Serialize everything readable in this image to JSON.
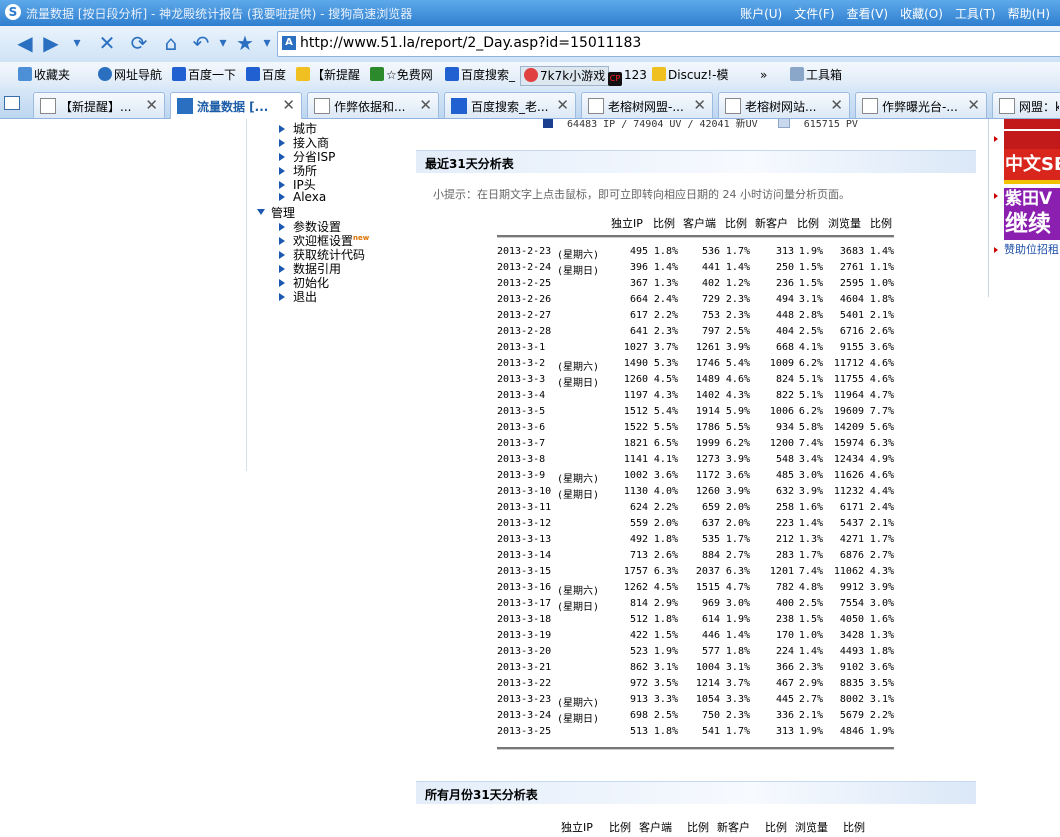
{
  "window": {
    "title": "流量数据 [按日段分析] - 神龙殿统计报告 (我要啦提供) - 搜狗高速浏览器",
    "menu": [
      "账户(U)",
      "文件(F)",
      "查看(V)",
      "收藏(O)",
      "工具(T)",
      "帮助(H)"
    ]
  },
  "address": {
    "url": "http://www.51.la/report/2_Day.asp?id=15011183"
  },
  "favorites": [
    "收藏夹",
    "网址导航",
    "百度一下",
    "百度",
    "【新提醒",
    "☆免费网",
    "百度搜索_",
    "7k7k小游戏",
    "123",
    "Discuz!-模",
    "»",
    "工具箱"
  ],
  "tabs": [
    {
      "label": "【新提醒】...",
      "active": false
    },
    {
      "label": "流量数据 [...",
      "active": true
    },
    {
      "label": "作弊依据和...",
      "active": false
    },
    {
      "label": "百度搜索_老...",
      "active": false
    },
    {
      "label": "老榕树网盟-...",
      "active": false
    },
    {
      "label": "老榕树网站...",
      "active": false
    },
    {
      "label": "作弊曝光台-...",
      "active": false
    },
    {
      "label": "网盟：k",
      "active": false
    }
  ],
  "sidebar": {
    "items_top": [
      "城市",
      "接入商",
      "分省ISP",
      "场所",
      "IP头",
      "Alexa"
    ],
    "group_label": "管理",
    "items_mgmt": [
      "参数设置",
      "欢迎框设置",
      "获取统计代码",
      "数据引用",
      "初始化",
      "退出"
    ],
    "new_badge": "new"
  },
  "legend": {
    "left_text": "64483 IP / 74904 UV / 42041 新UV",
    "right_text": "615715 PV",
    "color_left": "#1a3f8f",
    "color_right": "#c9d8ec"
  },
  "section1": {
    "title": "最近31天分析表",
    "hint": "小提示：在日期文字上点击鼠标，即可立即转向相应日期的 24 小时访问量分析页面。",
    "columns": [
      "独立IP",
      "比例",
      "客户端",
      "比例",
      "新客户",
      "比例",
      "浏览量",
      "比例"
    ],
    "rows": [
      {
        "date": "2013-2-23",
        "wd": "(星期六)",
        "ip": "495",
        "ipr": "1.8%",
        "cl": "536",
        "clr": "1.7%",
        "nc": "313",
        "ncr": "1.9%",
        "pv": "3683",
        "pvr": "1.4%"
      },
      {
        "date": "2013-2-24",
        "wd": "(星期日)",
        "ip": "396",
        "ipr": "1.4%",
        "cl": "441",
        "clr": "1.4%",
        "nc": "250",
        "ncr": "1.5%",
        "pv": "2761",
        "pvr": "1.1%"
      },
      {
        "date": "2013-2-25",
        "wd": "",
        "ip": "367",
        "ipr": "1.3%",
        "cl": "402",
        "clr": "1.2%",
        "nc": "236",
        "ncr": "1.5%",
        "pv": "2595",
        "pvr": "1.0%"
      },
      {
        "date": "2013-2-26",
        "wd": "",
        "ip": "664",
        "ipr": "2.4%",
        "cl": "729",
        "clr": "2.3%",
        "nc": "494",
        "ncr": "3.1%",
        "pv": "4604",
        "pvr": "1.8%"
      },
      {
        "date": "2013-2-27",
        "wd": "",
        "ip": "617",
        "ipr": "2.2%",
        "cl": "753",
        "clr": "2.3%",
        "nc": "448",
        "ncr": "2.8%",
        "pv": "5401",
        "pvr": "2.1%"
      },
      {
        "date": "2013-2-28",
        "wd": "",
        "ip": "641",
        "ipr": "2.3%",
        "cl": "797",
        "clr": "2.5%",
        "nc": "404",
        "ncr": "2.5%",
        "pv": "6716",
        "pvr": "2.6%"
      },
      {
        "date": "2013-3-1",
        "wd": "",
        "ip": "1027",
        "ipr": "3.7%",
        "cl": "1261",
        "clr": "3.9%",
        "nc": "668",
        "ncr": "4.1%",
        "pv": "9155",
        "pvr": "3.6%"
      },
      {
        "date": "2013-3-2",
        "wd": "(星期六)",
        "ip": "1490",
        "ipr": "5.3%",
        "cl": "1746",
        "clr": "5.4%",
        "nc": "1009",
        "ncr": "6.2%",
        "pv": "11712",
        "pvr": "4.6%"
      },
      {
        "date": "2013-3-3",
        "wd": "(星期日)",
        "ip": "1260",
        "ipr": "4.5%",
        "cl": "1489",
        "clr": "4.6%",
        "nc": "824",
        "ncr": "5.1%",
        "pv": "11755",
        "pvr": "4.6%"
      },
      {
        "date": "2013-3-4",
        "wd": "",
        "ip": "1197",
        "ipr": "4.3%",
        "cl": "1402",
        "clr": "4.3%",
        "nc": "822",
        "ncr": "5.1%",
        "pv": "11964",
        "pvr": "4.7%"
      },
      {
        "date": "2013-3-5",
        "wd": "",
        "ip": "1512",
        "ipr": "5.4%",
        "cl": "1914",
        "clr": "5.9%",
        "nc": "1006",
        "ncr": "6.2%",
        "pv": "19609",
        "pvr": "7.7%"
      },
      {
        "date": "2013-3-6",
        "wd": "",
        "ip": "1522",
        "ipr": "5.5%",
        "cl": "1786",
        "clr": "5.5%",
        "nc": "934",
        "ncr": "5.8%",
        "pv": "14209",
        "pvr": "5.6%"
      },
      {
        "date": "2013-3-7",
        "wd": "",
        "ip": "1821",
        "ipr": "6.5%",
        "cl": "1999",
        "clr": "6.2%",
        "nc": "1200",
        "ncr": "7.4%",
        "pv": "15974",
        "pvr": "6.3%"
      },
      {
        "date": "2013-3-8",
        "wd": "",
        "ip": "1141",
        "ipr": "4.1%",
        "cl": "1273",
        "clr": "3.9%",
        "nc": "548",
        "ncr": "3.4%",
        "pv": "12434",
        "pvr": "4.9%"
      },
      {
        "date": "2013-3-9",
        "wd": "(星期六)",
        "ip": "1002",
        "ipr": "3.6%",
        "cl": "1172",
        "clr": "3.6%",
        "nc": "485",
        "ncr": "3.0%",
        "pv": "11626",
        "pvr": "4.6%"
      },
      {
        "date": "2013-3-10",
        "wd": "(星期日)",
        "ip": "1130",
        "ipr": "4.0%",
        "cl": "1260",
        "clr": "3.9%",
        "nc": "632",
        "ncr": "3.9%",
        "pv": "11232",
        "pvr": "4.4%"
      },
      {
        "date": "2013-3-11",
        "wd": "",
        "ip": "624",
        "ipr": "2.2%",
        "cl": "659",
        "clr": "2.0%",
        "nc": "258",
        "ncr": "1.6%",
        "pv": "6171",
        "pvr": "2.4%"
      },
      {
        "date": "2013-3-12",
        "wd": "",
        "ip": "559",
        "ipr": "2.0%",
        "cl": "637",
        "clr": "2.0%",
        "nc": "223",
        "ncr": "1.4%",
        "pv": "5437",
        "pvr": "2.1%"
      },
      {
        "date": "2013-3-13",
        "wd": "",
        "ip": "492",
        "ipr": "1.8%",
        "cl": "535",
        "clr": "1.7%",
        "nc": "212",
        "ncr": "1.3%",
        "pv": "4271",
        "pvr": "1.7%"
      },
      {
        "date": "2013-3-14",
        "wd": "",
        "ip": "713",
        "ipr": "2.6%",
        "cl": "884",
        "clr": "2.7%",
        "nc": "283",
        "ncr": "1.7%",
        "pv": "6876",
        "pvr": "2.7%"
      },
      {
        "date": "2013-3-15",
        "wd": "",
        "ip": "1757",
        "ipr": "6.3%",
        "cl": "2037",
        "clr": "6.3%",
        "nc": "1201",
        "ncr": "7.4%",
        "pv": "11062",
        "pvr": "4.3%"
      },
      {
        "date": "2013-3-16",
        "wd": "(星期六)",
        "ip": "1262",
        "ipr": "4.5%",
        "cl": "1515",
        "clr": "4.7%",
        "nc": "782",
        "ncr": "4.8%",
        "pv": "9912",
        "pvr": "3.9%"
      },
      {
        "date": "2013-3-17",
        "wd": "(星期日)",
        "ip": "814",
        "ipr": "2.9%",
        "cl": "969",
        "clr": "3.0%",
        "nc": "400",
        "ncr": "2.5%",
        "pv": "7554",
        "pvr": "3.0%"
      },
      {
        "date": "2013-3-18",
        "wd": "",
        "ip": "512",
        "ipr": "1.8%",
        "cl": "614",
        "clr": "1.9%",
        "nc": "238",
        "ncr": "1.5%",
        "pv": "4050",
        "pvr": "1.6%"
      },
      {
        "date": "2013-3-19",
        "wd": "",
        "ip": "422",
        "ipr": "1.5%",
        "cl": "446",
        "clr": "1.4%",
        "nc": "170",
        "ncr": "1.0%",
        "pv": "3428",
        "pvr": "1.3%"
      },
      {
        "date": "2013-3-20",
        "wd": "",
        "ip": "523",
        "ipr": "1.9%",
        "cl": "577",
        "clr": "1.8%",
        "nc": "224",
        "ncr": "1.4%",
        "pv": "4493",
        "pvr": "1.8%"
      },
      {
        "date": "2013-3-21",
        "wd": "",
        "ip": "862",
        "ipr": "3.1%",
        "cl": "1004",
        "clr": "3.1%",
        "nc": "366",
        "ncr": "2.3%",
        "pv": "9102",
        "pvr": "3.6%"
      },
      {
        "date": "2013-3-22",
        "wd": "",
        "ip": "972",
        "ipr": "3.5%",
        "cl": "1214",
        "clr": "3.7%",
        "nc": "467",
        "ncr": "2.9%",
        "pv": "8835",
        "pvr": "3.5%"
      },
      {
        "date": "2013-3-23",
        "wd": "(星期六)",
        "ip": "913",
        "ipr": "3.3%",
        "cl": "1054",
        "clr": "3.3%",
        "nc": "445",
        "ncr": "2.7%",
        "pv": "8002",
        "pvr": "3.1%"
      },
      {
        "date": "2013-3-24",
        "wd": "(星期日)",
        "ip": "698",
        "ipr": "2.5%",
        "cl": "750",
        "clr": "2.3%",
        "nc": "336",
        "ncr": "2.1%",
        "pv": "5679",
        "pvr": "2.2%"
      },
      {
        "date": "2013-3-25",
        "wd": "",
        "ip": "513",
        "ipr": "1.8%",
        "cl": "541",
        "clr": "1.7%",
        "nc": "313",
        "ncr": "1.9%",
        "pv": "4846",
        "pvr": "1.9%"
      }
    ]
  },
  "section2": {
    "title": "所有月份31天分析表",
    "columns": [
      "独立IP",
      "比例",
      "客户端",
      "比例",
      "新客户",
      "比例",
      "浏览量",
      "比例"
    ]
  },
  "ads": {
    "ad1": "中文SE",
    "ad2_line1": "紫田V",
    "ad2_line2": "继续",
    "link": "赞助位招租"
  }
}
